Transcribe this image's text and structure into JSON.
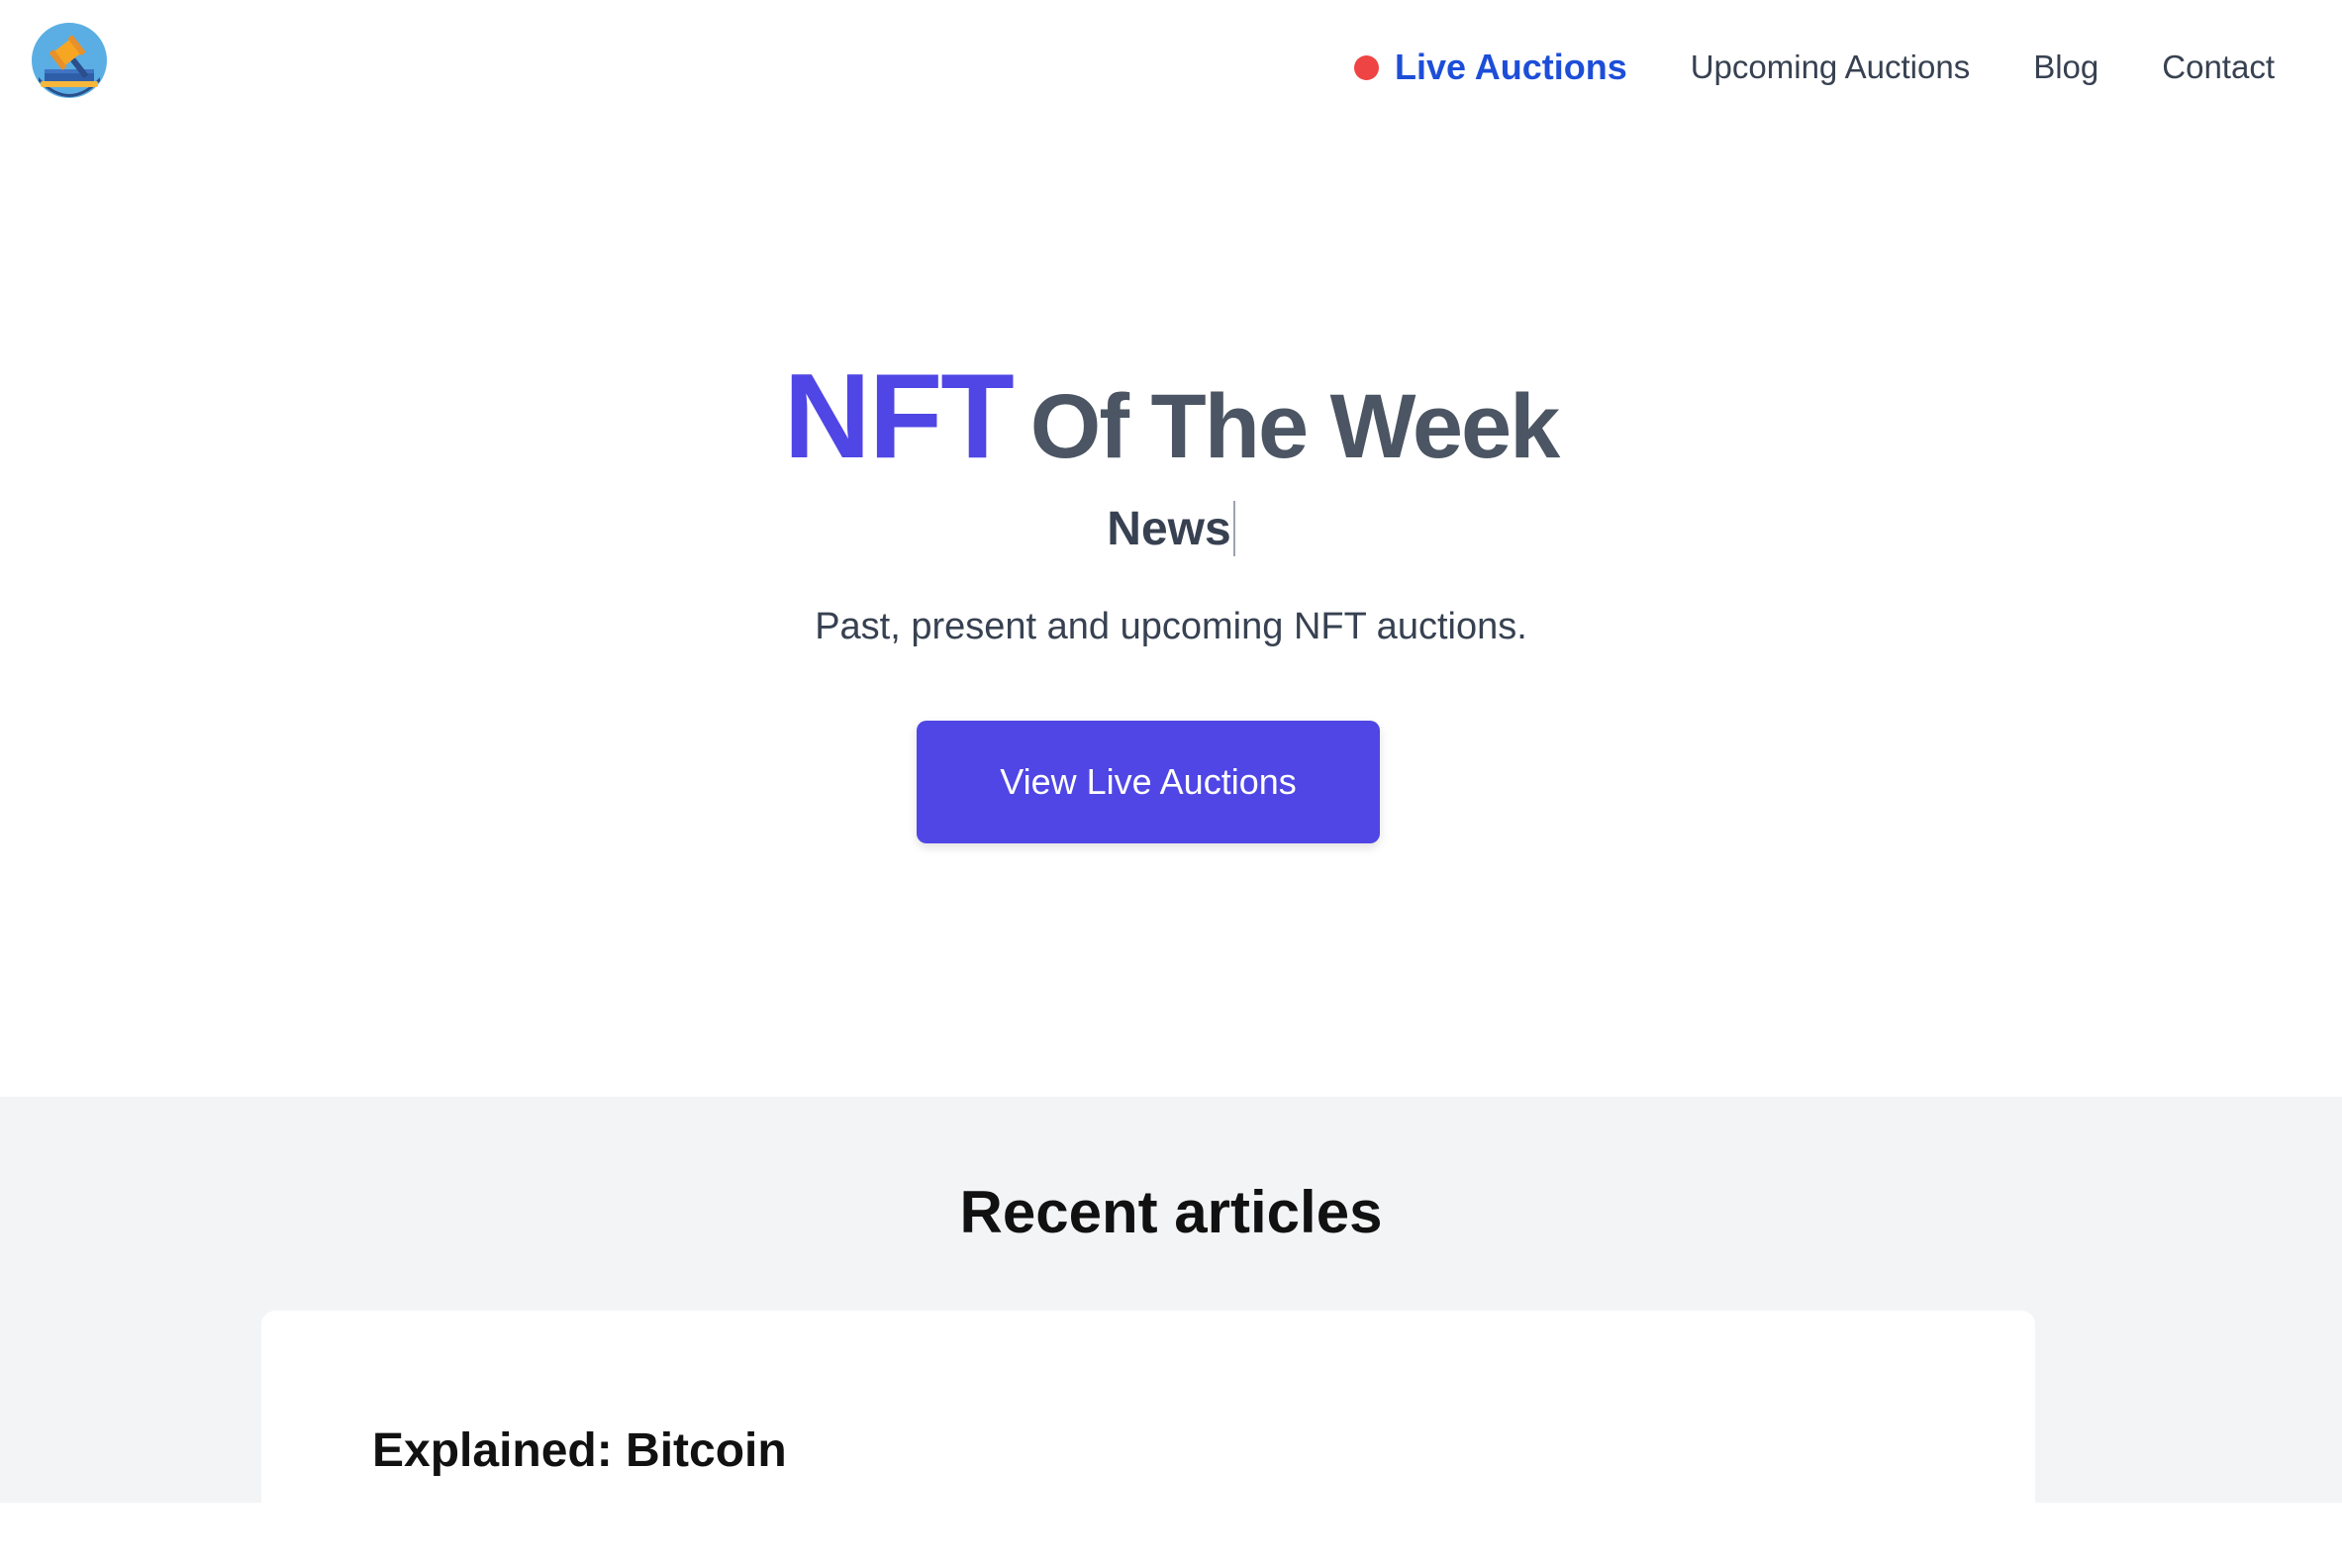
{
  "header": {
    "logo_icon": "auction-gavel-icon",
    "nav": {
      "live_auctions": "Live Auctions",
      "upcoming_auctions": "Upcoming Auctions",
      "blog": "Blog",
      "contact": "Contact"
    }
  },
  "hero": {
    "title_accent": "NFT",
    "title_rest": "Of The Week",
    "subtitle": "News",
    "description": "Past, present and upcoming NFT auctions.",
    "cta_label": "View Live Auctions"
  },
  "articles": {
    "heading": "Recent articles",
    "items": [
      {
        "title": "Explained: Bitcoin"
      }
    ]
  },
  "colors": {
    "accent": "#4f46e5",
    "nav_active": "#1d4ed8",
    "live_dot": "#ef4444",
    "section_bg": "#f3f4f6"
  }
}
